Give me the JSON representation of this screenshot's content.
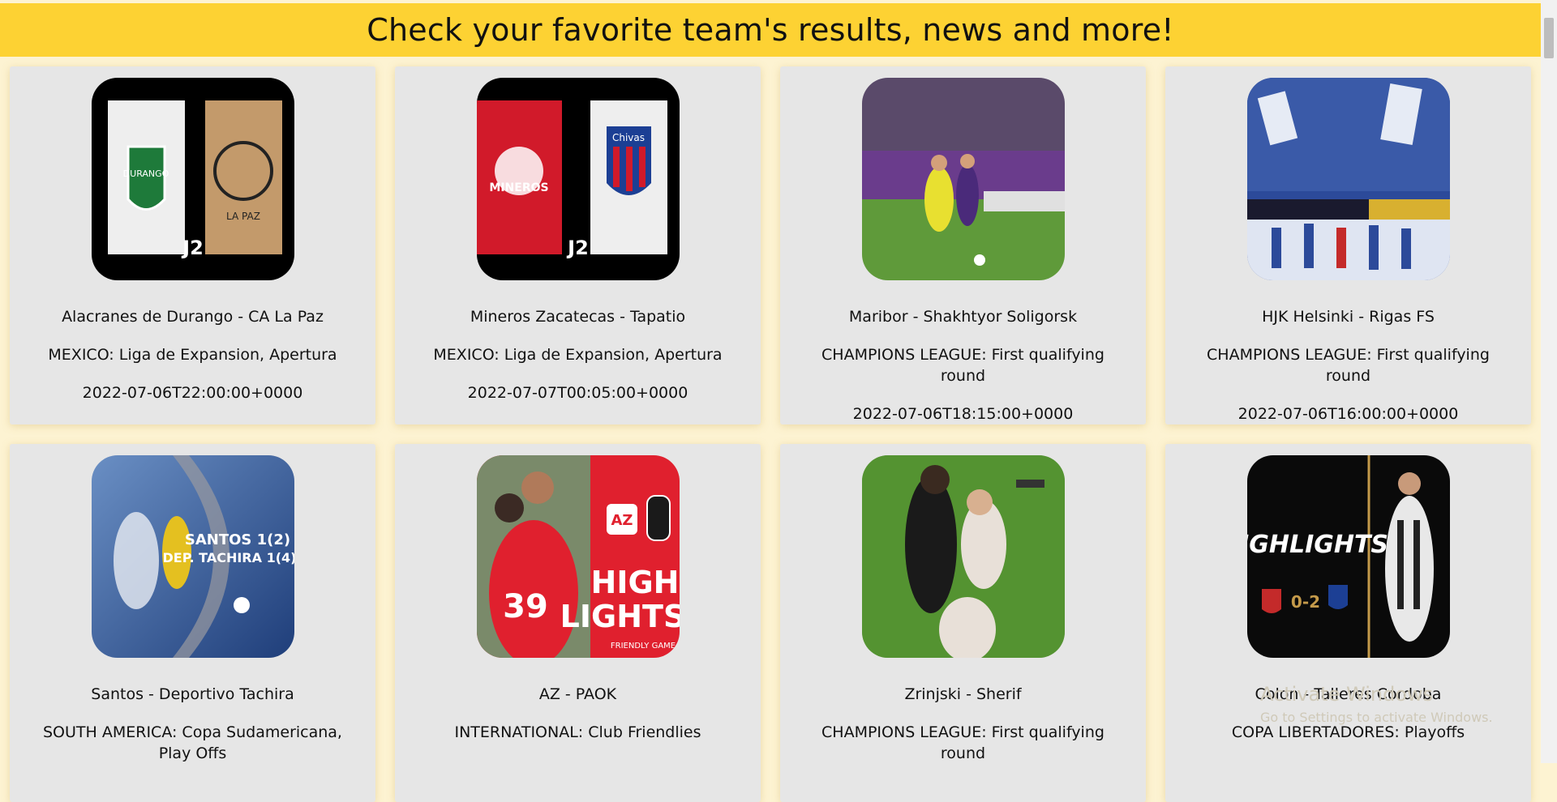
{
  "header": {
    "title": "Check your favorite team's results, news and more!"
  },
  "matches": [
    {
      "title": "Alacranes de Durango - CA La Paz",
      "competition": "MEXICO: Liga de Expansion, Apertura",
      "date": "2022-07-06T22:00:00+0000",
      "thumb_colors": [
        "#000000",
        "#f2f2f2",
        "#c39a6b"
      ]
    },
    {
      "title": "Mineros Zacatecas - Tapatio",
      "competition": "MEXICO: Liga de Expansion, Apertura",
      "date": "2022-07-07T00:05:00+0000",
      "thumb_colors": [
        "#000000",
        "#d11a2a",
        "#f2f2f2"
      ]
    },
    {
      "title": "Maribor - Shakhtyor Soligorsk",
      "competition": "CHAMPIONS LEAGUE: First qualifying round",
      "date": "2022-07-06T18:15:00+0000",
      "thumb_colors": [
        "#6a3c8c",
        "#5f9a3a",
        "#e8e030"
      ]
    },
    {
      "title": "HJK Helsinki - Rigas FS",
      "competition": "CHAMPIONS LEAGUE: First qualifying round",
      "date": "2022-07-06T16:00:00+0000",
      "thumb_colors": [
        "#2c4a9a",
        "#e6ebf5",
        "#c42a2a"
      ]
    },
    {
      "title": "Santos - Deportivo Tachira",
      "competition": "SOUTH AMERICA: Copa Sudamericana, Play Offs",
      "date": "",
      "thumb_colors": [
        "#1f3e7a",
        "#6a8fc4",
        "#ffffff"
      ]
    },
    {
      "title": "AZ - PAOK",
      "competition": "INTERNATIONAL: Club Friendlies",
      "date": "",
      "thumb_colors": [
        "#e0202e",
        "#3b2a24",
        "#ffffff"
      ]
    },
    {
      "title": "Zrinjski - Sherif",
      "competition": "CHAMPIONS LEAGUE: First qualifying round",
      "date": "",
      "thumb_colors": [
        "#4c8a2c",
        "#1a1a1a",
        "#e8e0d8"
      ]
    },
    {
      "title": "Colon - Talleres Cordoba",
      "competition": "COPA LIBERTADORES: Playoffs",
      "date": "",
      "thumb_colors": [
        "#0a0a0a",
        "#c49a4a",
        "#ffffff"
      ]
    }
  ],
  "thumbnail_text": {
    "durango": "DURANGO",
    "la_paz": "LA PAZ",
    "j2": "J2",
    "mineros": "MINEROS",
    "chivas": "Chivas",
    "santos_score": "SANTOS 1(2)",
    "tachira_score": "DEP. TACHIRA 1(4)",
    "az": "AZ",
    "high": "HIGH",
    "lights": "LIGHTS",
    "friendly": "FRIENDLY GAME",
    "highlights": "HIGHLIGHTS",
    "colon_score": "0-2"
  },
  "watermark": {
    "line1": "Activate Windows",
    "line2": "Go to Settings to activate Windows."
  }
}
